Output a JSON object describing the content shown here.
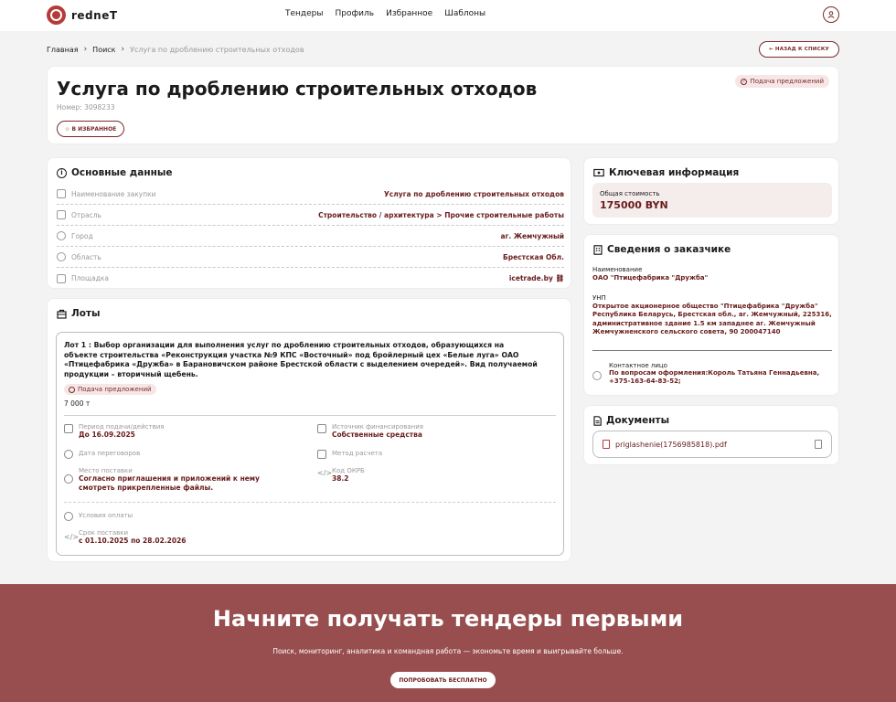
{
  "header": {
    "logo_text": "redneT",
    "nav": [
      "Тендеры",
      "Профиль",
      "Избранное",
      "Шаблоны"
    ]
  },
  "breadcrumb": {
    "home": "Главная",
    "search": "Поиск",
    "current": "Услуга по дроблению строительных отходов",
    "back_label": "← НАЗАД К СПИСКУ"
  },
  "tender": {
    "title": "Услуга по дроблению строительных отходов",
    "number": "Номер: 3098233",
    "fav_label": "☆ В ИЗБРАННОЕ",
    "status": "Подача предложений"
  },
  "main": {
    "title": "Основные данные",
    "rows": [
      {
        "label": "Наименование закупки",
        "value": "Услуга по дроблению строительных отходов"
      },
      {
        "label": "Отрасль",
        "value": "Строительство / архитектура > Прочие строительные работы"
      },
      {
        "label": "Город",
        "value": "аг. Жемчужный"
      },
      {
        "label": "Область",
        "value": "Брестская Обл."
      },
      {
        "label": "Площадка",
        "value": "icetrade.by ⛓"
      }
    ]
  },
  "lots": {
    "title": "Лоты",
    "lot": {
      "description": "Лот 1 : Выбор организации для выполнения услуг по дроблению строительных отходов, образующихся на объекте строительства «Реконструкция участка №9 КПС «Восточный» под бройлерный цех «Белые луга» ОАО «Птицефабрика «Дружба» в Барановичском районе Брестской области с выделением очередей». Вид получаемой продукции – вторичный щебень.",
      "status": "Подача предложений",
      "quantity": "7 000 т",
      "period_label": "Период подачи/действия",
      "period_value": "До 16.09.2025",
      "finance_label": "Источник финансирования",
      "finance_value": "Собственные средства",
      "negotiation_label": "Дата переговоров",
      "calc_label": "Метод расчета",
      "place_label": "Место поставки",
      "place_value": "Согласно приглашения и приложений к нему смотреть прикрепленные файлы.",
      "okrb_label": "Код ОКРБ",
      "okrb_value": "38.2",
      "payment_label": "Условия оплаты",
      "delivery_label": "Срок поставки",
      "delivery_value": "с 01.10.2025 по 28.02.2026"
    }
  },
  "key": {
    "title": "Ключевая информация",
    "cost_label": "Общая стоимость",
    "cost_value": "175000 BYN"
  },
  "customer": {
    "title": "Сведения о заказчике",
    "name_label": "Наименование",
    "name_value": "ОАО \"Птицефабрика \"Дружба\"",
    "unp_label": "УНП",
    "unp_value": "Открытое акционерное общество \"Птицефабрика \"Дружба\" Республика Беларусь, Брестская обл., аг. Жемчужный, 225316, административное здание 1.5 км западнее аг. Жемчужный Жемчужненского сельского совета, 90 200047140",
    "contact_label": "Контактное лицо",
    "contact_value": "По вопросам оформления:Король Татьяна Геннадьевна, +375-163-64-83-52;"
  },
  "docs": {
    "title": "Документы",
    "file": "priglashenie(1756985818).pdf"
  },
  "banner": {
    "title": "Начните получать тендеры первыми",
    "subtitle": "Поиск, мониторинг, аналитика и командная работа — экономьте время и выигрывайте больше.",
    "cta": "ПОПРОБОВАТЬ БЕСПЛАТНО"
  }
}
